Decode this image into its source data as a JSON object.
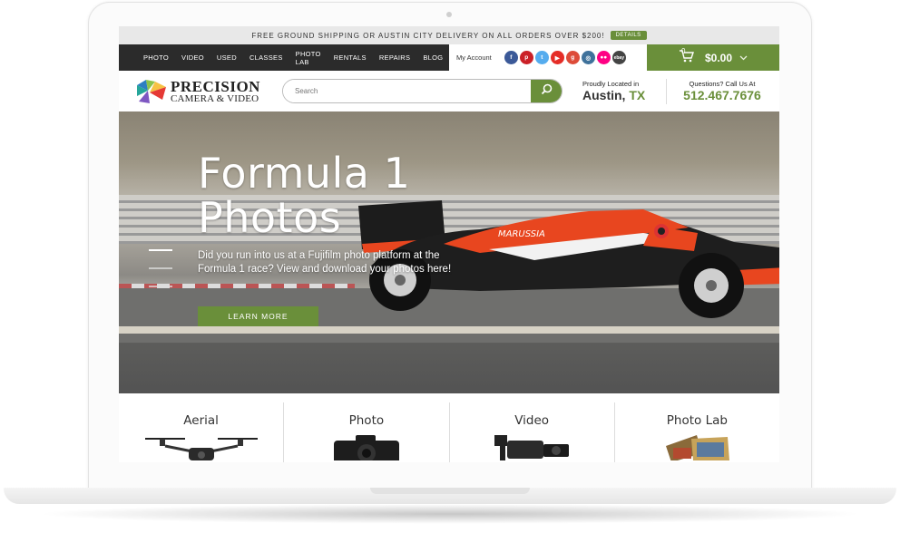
{
  "promo": {
    "text": "FREE GROUND SHIPPING OR AUSTIN CITY DELIVERY ON ALL ORDERS OVER $200!",
    "details_label": "DETAILS"
  },
  "nav": {
    "items": [
      "PHOTO",
      "VIDEO",
      "USED",
      "CLASSES",
      "PHOTO LAB",
      "RENTALS",
      "REPAIRS",
      "BLOG"
    ],
    "account_label": "My Account"
  },
  "social": [
    {
      "name": "facebook-icon",
      "glyph": "f",
      "color": "#3b5998"
    },
    {
      "name": "pinterest-icon",
      "glyph": "p",
      "color": "#cb2027"
    },
    {
      "name": "twitter-icon",
      "glyph": "t",
      "color": "#55acee"
    },
    {
      "name": "youtube-icon",
      "glyph": "▶",
      "color": "#e52d27"
    },
    {
      "name": "google-plus-icon",
      "glyph": "g",
      "color": "#dd4b39"
    },
    {
      "name": "instagram-icon",
      "glyph": "◎",
      "color": "#3f729b"
    },
    {
      "name": "flickr-icon",
      "glyph": "●●",
      "color": "#ff0084"
    },
    {
      "name": "ebay-icon",
      "glyph": "ebay",
      "color": "#444444"
    }
  ],
  "cart": {
    "count": "0",
    "total": "$0.00"
  },
  "brand": {
    "line1": "PRECISION",
    "line2": "CAMERA & VIDEO"
  },
  "search": {
    "placeholder": "Search"
  },
  "location": {
    "label": "Proudly Located in",
    "city": "Austin,",
    "state": "TX"
  },
  "contact": {
    "label": "Questions? Call Us At",
    "phone": "512.467.7676"
  },
  "hero": {
    "title_line1": "Formula 1",
    "title_line2": "Photos",
    "body": "Did you run into us at a Fujifilm photo platform at the Formula 1 race? View and download your photos here!",
    "cta_label": "LEARN MORE",
    "car_text": "MARUSSIA"
  },
  "categories": [
    "Aerial",
    "Photo",
    "Video",
    "Photo Lab"
  ],
  "colors": {
    "accent": "#6a8f3a",
    "nav_bg": "#2b2b2b",
    "promo_bg": "#e8e8e8"
  }
}
